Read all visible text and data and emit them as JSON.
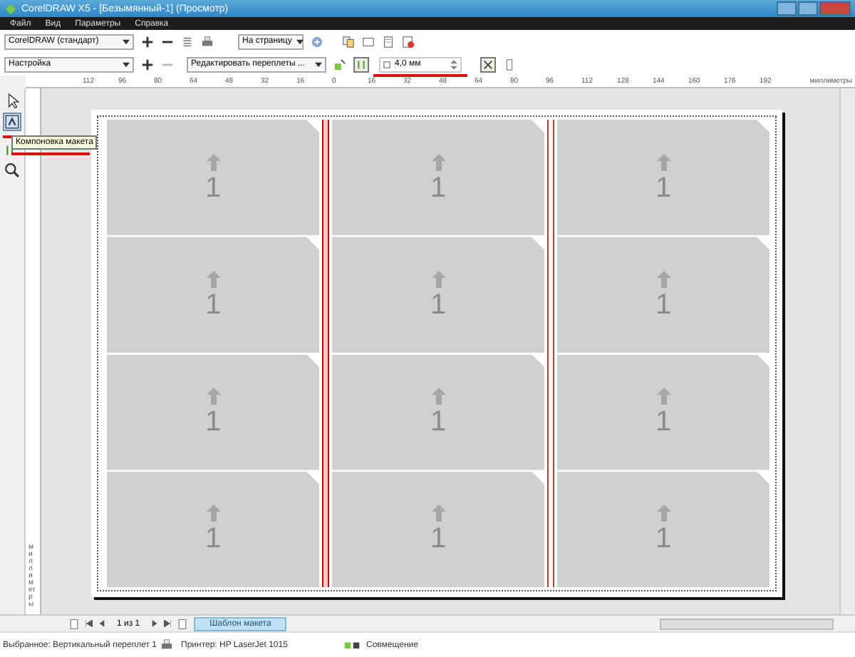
{
  "window": {
    "title": "CorelDRAW X5 - [Безымянный-1] (Просмотр)"
  },
  "menu": [
    "Файл",
    "Вид",
    "Параметры",
    "Справка"
  ],
  "toolbar_1": {
    "preset": "CorelDRAW (стандарт)",
    "fit": "На страницу"
  },
  "toolbar_2": {
    "settings": "Настройка",
    "gutters": "Редактировать переплеты ...",
    "gutter_width": "4,0 мм"
  },
  "ruler": {
    "ticks": [
      "112",
      "96",
      "80",
      "64",
      "48",
      "32",
      "16",
      "0",
      "16",
      "32",
      "48",
      "64",
      "80",
      "96",
      "112",
      "128",
      "144",
      "160",
      "176",
      "192"
    ],
    "unit": "миллиметры"
  },
  "vertical_ruler": {
    "unit": "миллиметры"
  },
  "tooltip": "Компоновка макета",
  "layout": {
    "cards": [
      {
        "label": "1"
      },
      {
        "label": "1"
      },
      {
        "label": "1"
      },
      {
        "label": "1"
      },
      {
        "label": "1"
      },
      {
        "label": "1"
      },
      {
        "label": "1"
      },
      {
        "label": "1"
      },
      {
        "label": "1"
      },
      {
        "label": "1"
      },
      {
        "label": "1"
      },
      {
        "label": "1"
      }
    ],
    "gutters": [
      {
        "selected": true
      },
      {
        "selected": false
      }
    ]
  },
  "page_nav": {
    "position": "1 из 1",
    "tab": "Шаблон макета"
  },
  "status_bar": {
    "selection": "Выбранное: Вертикальный переплет 1",
    "printer": "Принтер: HP LaserJet 1015",
    "mode": "Совмещение"
  }
}
